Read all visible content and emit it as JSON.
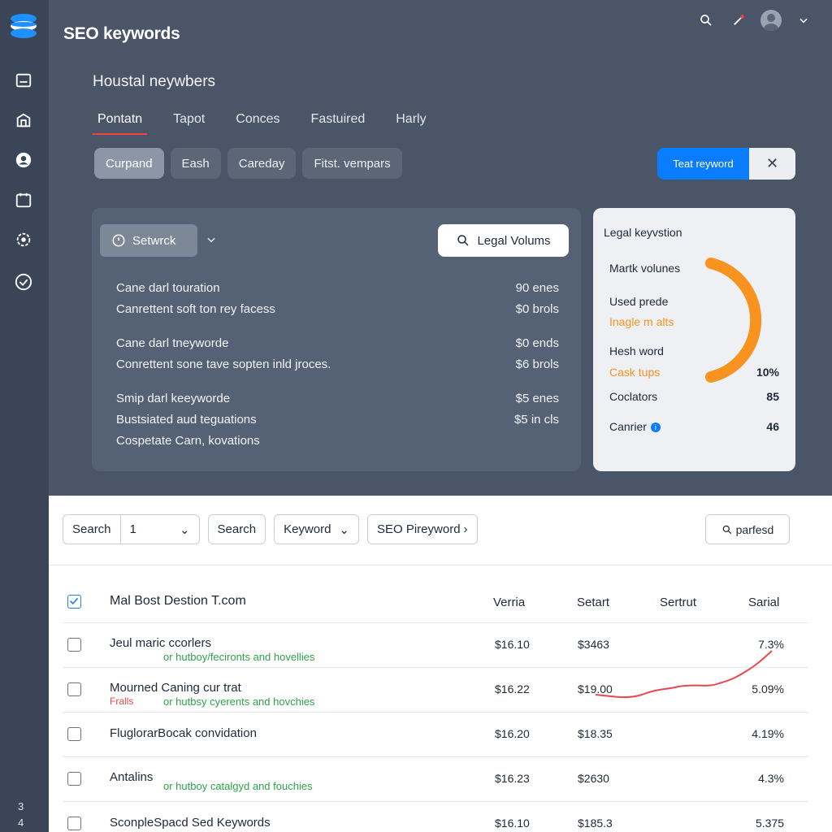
{
  "app": {
    "title": "SEO keywords"
  },
  "section": {
    "title": "Houstal neywbers"
  },
  "tabs": [
    {
      "label": "Pontatn"
    },
    {
      "label": "Tapot"
    },
    {
      "label": "Conces"
    },
    {
      "label": "Fastuired"
    },
    {
      "label": "Harly"
    }
  ],
  "chips": [
    {
      "label": "Curpand"
    },
    {
      "label": "Eash"
    },
    {
      "label": "Careday"
    },
    {
      "label": "Fitst.  vempars"
    }
  ],
  "cta": {
    "label": "Teat reyword"
  },
  "card": {
    "network_label": "Setwrck",
    "volumes_label": "Legal Volums",
    "rows": [
      {
        "text": "Cane darl touration",
        "value": "90 enes"
      },
      {
        "text": "Canrettent soft ton rey facess",
        "value": "$0 brols"
      },
      {
        "text": "Cane darl tneyworde",
        "value": "$0 ends"
      },
      {
        "text": "Conrettent sone tave sopten inld jroces.",
        "value": "$6 brols"
      },
      {
        "text": "Smip darl keeyworde",
        "value": "$5 enes"
      },
      {
        "text": "Bustsiated aud teguations",
        "value": "$5 in cls"
      },
      {
        "text": "Cospetate Carn, kovations",
        "value": ""
      }
    ]
  },
  "summary": {
    "title": "Legal keyvstion",
    "items": [
      {
        "label": "Martk volunes"
      },
      {
        "label": "Used prede"
      },
      {
        "label": "Inagle m alts"
      },
      {
        "label": "Hesh word"
      },
      {
        "label": "Cask tups"
      },
      {
        "label": "Coclators"
      },
      {
        "label": "Canrier"
      }
    ],
    "percent": "10%",
    "num1": "85",
    "num2": "46",
    "arc_color": "#f7931e"
  },
  "filters": {
    "search_label": "Search",
    "search_value": "1",
    "search_button": "Search",
    "keyword_label": "Keyword",
    "seo_label": "SEO Pireyword",
    "parsed_label": "parfesd"
  },
  "table": {
    "headers": {
      "name": "Mal Bost Destion T.com",
      "c1": "Verria",
      "c2": "Setart",
      "c3": "Sertrut",
      "c4": "Sarial"
    },
    "rows": [
      {
        "name": "Jeul maric ccorlers",
        "sub": "or hutboy/fecironts and hovellies",
        "tag": "",
        "v1": "$16.10",
        "v2": "$3463",
        "v4": "7.3%"
      },
      {
        "name": "Mourned Caning cur trat",
        "sub": "or hutbsy cyerents and hovchies",
        "tag": "Fralls",
        "v1": "$16.22",
        "v2": "$19.00",
        "v4": "5.09%"
      },
      {
        "name": "FluglorarBocak convidation",
        "sub": "",
        "tag": "",
        "v1": "$16.20",
        "v2": "$18.35",
        "v4": "4.19%"
      },
      {
        "name": "Antalins",
        "sub": "or hutboy catalgyd and fouchies",
        "tag": "",
        "v1": "$16.23",
        "v2": "$2630",
        "v4": "4.3%"
      },
      {
        "name": "SconpleSpacd Sed Keywords",
        "sub": "",
        "tag": "",
        "v1": "$16.10",
        "v2": "$185.3",
        "v4": "5.375"
      }
    ]
  },
  "sidebar": {
    "footer_top": "3",
    "footer_bottom": "4"
  },
  "colors": {
    "accent": "#0a7cff",
    "orange": "#f7931e",
    "green": "#2fa24a",
    "trend": "#e5484d"
  }
}
